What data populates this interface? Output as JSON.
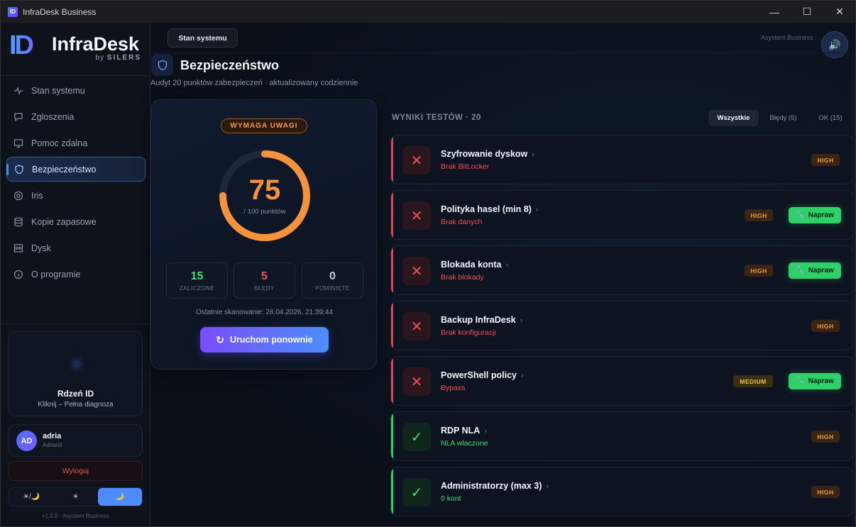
{
  "window": {
    "title": "InfraDesk Business",
    "app_icon": "ID",
    "minimize": "—",
    "maximize": "☐",
    "close": "✕"
  },
  "brand": {
    "mark": "ID",
    "name": "InfraDesk",
    "by": "by",
    "company": "SILERS"
  },
  "sidebar": {
    "items": [
      {
        "label": "Stan systemu",
        "icon": "pulse-icon"
      },
      {
        "label": "Zgloszenia",
        "icon": "chat-icon"
      },
      {
        "label": "Pomoc zdalna",
        "icon": "monitor-icon"
      },
      {
        "label": "Bezpieczeństwo",
        "icon": "shield-icon",
        "active": true
      },
      {
        "label": "Iris",
        "icon": "target-icon"
      },
      {
        "label": "Kopie zapasowe",
        "icon": "database-icon"
      },
      {
        "label": "Dysk",
        "icon": "server-icon"
      },
      {
        "label": "O programie",
        "icon": "info-icon"
      }
    ],
    "core": {
      "title": "Rdzeń ID",
      "subtitle": "Kliknij – Pełna diagnoza"
    },
    "user": {
      "initials": "AD",
      "name": "adria",
      "host": "Adrian0"
    },
    "logout": "Wyloguj",
    "theme": {
      "auto": "☀/🌙",
      "light": "☀",
      "dark": "🌙",
      "selected": "dark"
    },
    "version": "v1.0.0 · Asystent Business"
  },
  "topbar": {
    "tab": "Stan systemu",
    "assistant": "Asystent Business ·",
    "speaker_icon": "🔊"
  },
  "header": {
    "title": "Bezpieczeństwo",
    "subtitle": "Audyt 20 punktów zabezpieczeń · aktualizowany codziennie"
  },
  "score_card": {
    "badge": "WYMAGA UWAGI",
    "score": "75",
    "score_fraction": 0.75,
    "score_label": "/ 100 punktów",
    "stats": [
      {
        "value": "15",
        "label": "ZALICZONE",
        "color": "#3ee07a"
      },
      {
        "value": "5",
        "label": "BŁĘDY",
        "color": "#f0505a"
      },
      {
        "value": "0",
        "label": "POMINIĘTE",
        "color": "#c5ccd8"
      }
    ],
    "last_scan": "Ostatnie skanowanie: 26.04.2026, 21:39:44",
    "rerun": "Uruchom ponownie"
  },
  "results": {
    "heading": "WYNIKI TESTÓW · 20",
    "filters": [
      {
        "label": "Wszystkie",
        "active": true
      },
      {
        "label": "Błędy (5)",
        "active": false
      },
      {
        "label": "OK (15)",
        "active": false
      }
    ],
    "fix_label": "Napraw",
    "items": [
      {
        "name": "Szyfrowanie dyskow",
        "detail": "Brak BitLocker",
        "status": "fail",
        "severity": "HIGH",
        "fix": false
      },
      {
        "name": "Polityka hasel (min 8)",
        "detail": "Brak danych",
        "status": "fail",
        "severity": "HIGH",
        "fix": true
      },
      {
        "name": "Blokada konta",
        "detail": "Brak blokady",
        "status": "fail",
        "severity": "HIGH",
        "fix": true
      },
      {
        "name": "Backup InfraDesk",
        "detail": "Brak konfiguracji",
        "status": "fail",
        "severity": "HIGH",
        "fix": false
      },
      {
        "name": "PowerShell policy",
        "detail": "Bypass",
        "status": "fail",
        "severity": "MEDIUM",
        "fix": true
      },
      {
        "name": "RDP NLA",
        "detail": "NLA wlaczone",
        "status": "pass",
        "severity": "HIGH",
        "fix": false
      },
      {
        "name": "Administratorzy (max 3)",
        "detail": "0 kont",
        "status": "pass",
        "severity": "HIGH",
        "fix": false
      }
    ]
  },
  "colors": {
    "accent": "#4d8dff",
    "warning": "#f5923a",
    "fail": "#f0505a",
    "pass": "#3ee07a"
  }
}
